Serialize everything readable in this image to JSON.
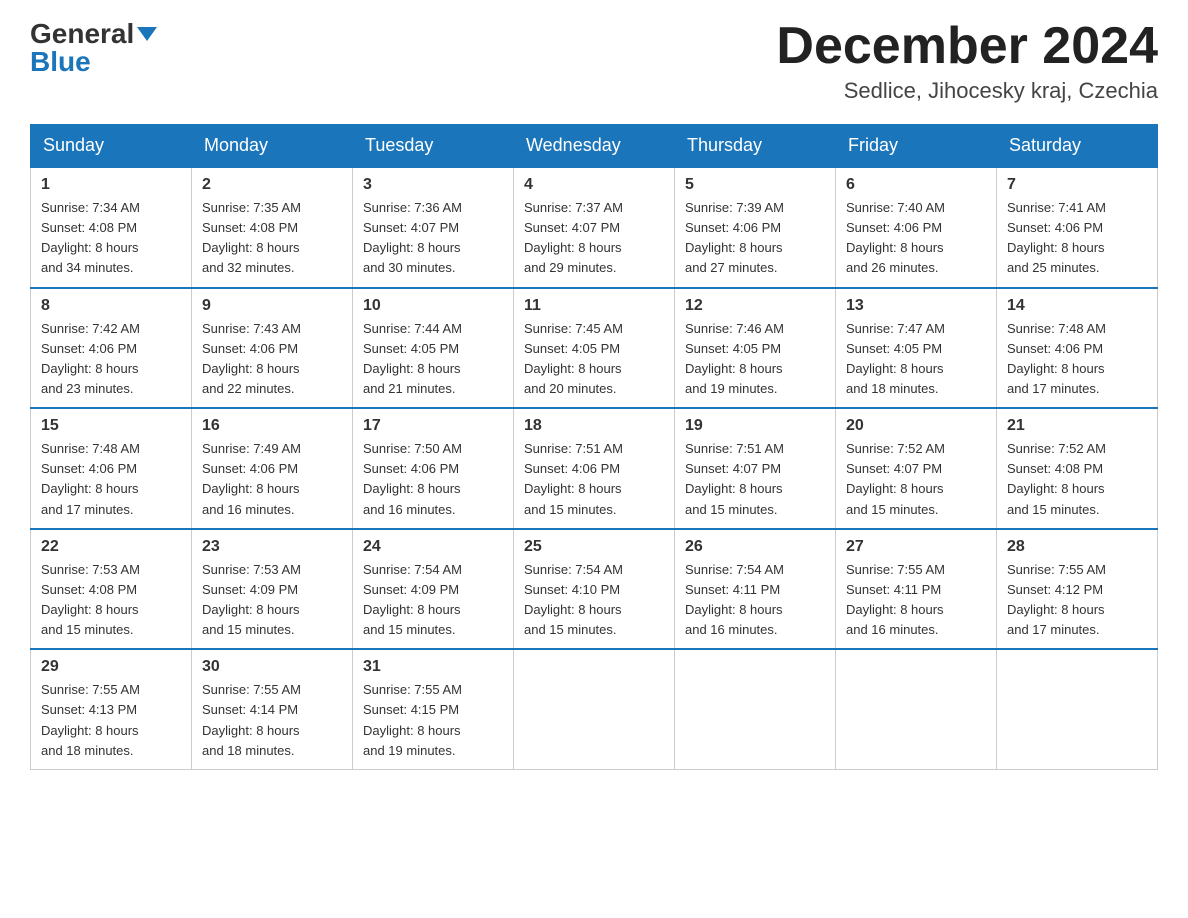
{
  "header": {
    "logo_general": "General",
    "logo_blue": "Blue",
    "month_title": "December 2024",
    "location": "Sedlice, Jihocesky kraj, Czechia"
  },
  "days_of_week": [
    "Sunday",
    "Monday",
    "Tuesday",
    "Wednesday",
    "Thursday",
    "Friday",
    "Saturday"
  ],
  "weeks": [
    [
      {
        "num": "1",
        "sunrise": "7:34 AM",
        "sunset": "4:08 PM",
        "daylight": "8 hours and 34 minutes."
      },
      {
        "num": "2",
        "sunrise": "7:35 AM",
        "sunset": "4:08 PM",
        "daylight": "8 hours and 32 minutes."
      },
      {
        "num": "3",
        "sunrise": "7:36 AM",
        "sunset": "4:07 PM",
        "daylight": "8 hours and 30 minutes."
      },
      {
        "num": "4",
        "sunrise": "7:37 AM",
        "sunset": "4:07 PM",
        "daylight": "8 hours and 29 minutes."
      },
      {
        "num": "5",
        "sunrise": "7:39 AM",
        "sunset": "4:06 PM",
        "daylight": "8 hours and 27 minutes."
      },
      {
        "num": "6",
        "sunrise": "7:40 AM",
        "sunset": "4:06 PM",
        "daylight": "8 hours and 26 minutes."
      },
      {
        "num": "7",
        "sunrise": "7:41 AM",
        "sunset": "4:06 PM",
        "daylight": "8 hours and 25 minutes."
      }
    ],
    [
      {
        "num": "8",
        "sunrise": "7:42 AM",
        "sunset": "4:06 PM",
        "daylight": "8 hours and 23 minutes."
      },
      {
        "num": "9",
        "sunrise": "7:43 AM",
        "sunset": "4:06 PM",
        "daylight": "8 hours and 22 minutes."
      },
      {
        "num": "10",
        "sunrise": "7:44 AM",
        "sunset": "4:05 PM",
        "daylight": "8 hours and 21 minutes."
      },
      {
        "num": "11",
        "sunrise": "7:45 AM",
        "sunset": "4:05 PM",
        "daylight": "8 hours and 20 minutes."
      },
      {
        "num": "12",
        "sunrise": "7:46 AM",
        "sunset": "4:05 PM",
        "daylight": "8 hours and 19 minutes."
      },
      {
        "num": "13",
        "sunrise": "7:47 AM",
        "sunset": "4:05 PM",
        "daylight": "8 hours and 18 minutes."
      },
      {
        "num": "14",
        "sunrise": "7:48 AM",
        "sunset": "4:06 PM",
        "daylight": "8 hours and 17 minutes."
      }
    ],
    [
      {
        "num": "15",
        "sunrise": "7:48 AM",
        "sunset": "4:06 PM",
        "daylight": "8 hours and 17 minutes."
      },
      {
        "num": "16",
        "sunrise": "7:49 AM",
        "sunset": "4:06 PM",
        "daylight": "8 hours and 16 minutes."
      },
      {
        "num": "17",
        "sunrise": "7:50 AM",
        "sunset": "4:06 PM",
        "daylight": "8 hours and 16 minutes."
      },
      {
        "num": "18",
        "sunrise": "7:51 AM",
        "sunset": "4:06 PM",
        "daylight": "8 hours and 15 minutes."
      },
      {
        "num": "19",
        "sunrise": "7:51 AM",
        "sunset": "4:07 PM",
        "daylight": "8 hours and 15 minutes."
      },
      {
        "num": "20",
        "sunrise": "7:52 AM",
        "sunset": "4:07 PM",
        "daylight": "8 hours and 15 minutes."
      },
      {
        "num": "21",
        "sunrise": "7:52 AM",
        "sunset": "4:08 PM",
        "daylight": "8 hours and 15 minutes."
      }
    ],
    [
      {
        "num": "22",
        "sunrise": "7:53 AM",
        "sunset": "4:08 PM",
        "daylight": "8 hours and 15 minutes."
      },
      {
        "num": "23",
        "sunrise": "7:53 AM",
        "sunset": "4:09 PM",
        "daylight": "8 hours and 15 minutes."
      },
      {
        "num": "24",
        "sunrise": "7:54 AM",
        "sunset": "4:09 PM",
        "daylight": "8 hours and 15 minutes."
      },
      {
        "num": "25",
        "sunrise": "7:54 AM",
        "sunset": "4:10 PM",
        "daylight": "8 hours and 15 minutes."
      },
      {
        "num": "26",
        "sunrise": "7:54 AM",
        "sunset": "4:11 PM",
        "daylight": "8 hours and 16 minutes."
      },
      {
        "num": "27",
        "sunrise": "7:55 AM",
        "sunset": "4:11 PM",
        "daylight": "8 hours and 16 minutes."
      },
      {
        "num": "28",
        "sunrise": "7:55 AM",
        "sunset": "4:12 PM",
        "daylight": "8 hours and 17 minutes."
      }
    ],
    [
      {
        "num": "29",
        "sunrise": "7:55 AM",
        "sunset": "4:13 PM",
        "daylight": "8 hours and 18 minutes."
      },
      {
        "num": "30",
        "sunrise": "7:55 AM",
        "sunset": "4:14 PM",
        "daylight": "8 hours and 18 minutes."
      },
      {
        "num": "31",
        "sunrise": "7:55 AM",
        "sunset": "4:15 PM",
        "daylight": "8 hours and 19 minutes."
      },
      null,
      null,
      null,
      null
    ]
  ],
  "labels": {
    "sunrise": "Sunrise:",
    "sunset": "Sunset:",
    "daylight": "Daylight:"
  }
}
